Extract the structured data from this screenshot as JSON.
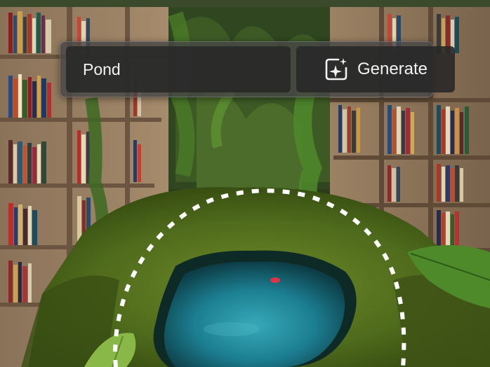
{
  "prompt_bar": {
    "input_value": "Pond",
    "generate_label": "Generate",
    "generate_icon": "generative-sparkle-icon"
  },
  "selection": {
    "shape": "dashed-circle",
    "color": "#ffffff"
  },
  "colors": {
    "bar_background": "#464646",
    "field_background": "#282828",
    "text": "#f2f2f2"
  }
}
